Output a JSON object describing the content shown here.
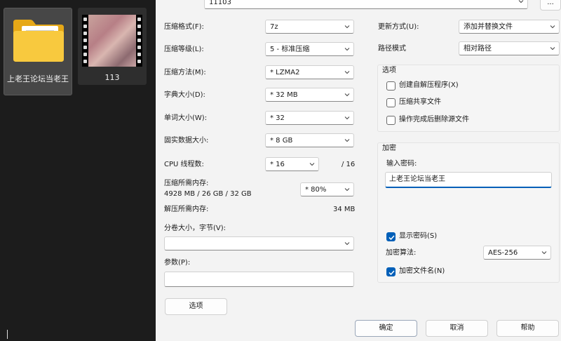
{
  "explorer": {
    "items": [
      {
        "name": "上老王论坛当老王",
        "type": "folder"
      },
      {
        "name": "113",
        "type": "video"
      }
    ]
  },
  "dialog": {
    "archive_name": "11103",
    "browse_label": "...",
    "fields": {
      "format": {
        "label": "压缩格式(F):",
        "value": "7z"
      },
      "level": {
        "label": "压缩等级(L):",
        "value": "5 - 标准压缩"
      },
      "method": {
        "label": "压缩方法(M):",
        "value": "* LZMA2"
      },
      "dict_size": {
        "label": "字典大小(D):",
        "value": "* 32 MB"
      },
      "word_size": {
        "label": "单词大小(W):",
        "value": "* 32"
      },
      "solid_block": {
        "label": "固实数据大小:",
        "value": "* 8 GB"
      },
      "threads": {
        "label": "CPU 线程数:",
        "value": "* 16",
        "total": "/ 16"
      },
      "mem_compress": {
        "label": "压缩所需内存:",
        "detail": "4928 MB / 26 GB / 32 GB",
        "value": "* 80%"
      },
      "mem_decompress": {
        "label": "解压所需内存:",
        "value": "34 MB"
      },
      "split": {
        "label": "分卷大小，字节(V):",
        "value": ""
      },
      "params": {
        "label": "参数(P):",
        "value": ""
      },
      "update_mode": {
        "label": "更新方式(U):",
        "value": "添加并替换文件"
      },
      "path_mode": {
        "label": "路径模式",
        "value": "相对路径"
      }
    },
    "options": {
      "title": "选项",
      "sfx": {
        "label": "创建自解压程序(X)",
        "checked": false
      },
      "shared": {
        "label": "压缩共享文件",
        "checked": false
      },
      "delete_after": {
        "label": "操作完成后删除源文件",
        "checked": false
      }
    },
    "encryption": {
      "title": "加密",
      "password_label": "输入密码:",
      "password_value": "上老王论坛当老王",
      "show_password": {
        "label": "显示密码(S)",
        "checked": true
      },
      "method_label": "加密算法:",
      "method_value": "AES-256",
      "encrypt_names": {
        "label": "加密文件名(N)",
        "checked": true
      }
    },
    "buttons": {
      "options": "选项",
      "ok": "确定",
      "cancel": "取消",
      "help": "帮助"
    }
  }
}
